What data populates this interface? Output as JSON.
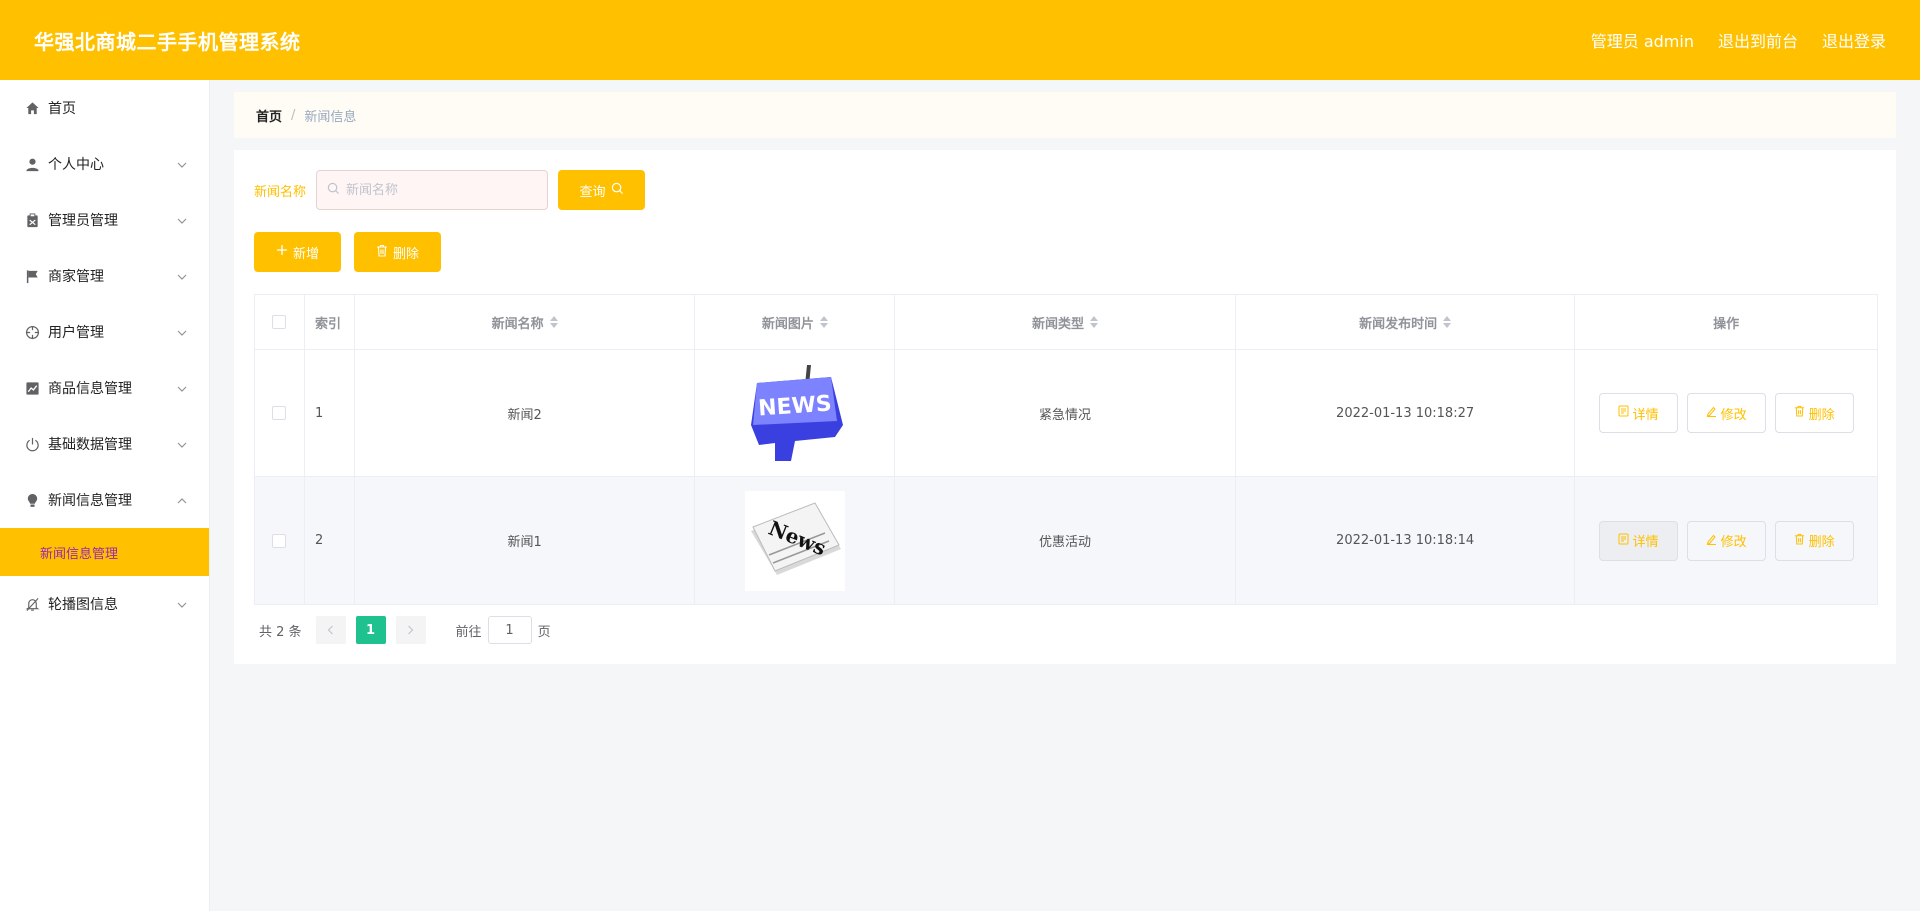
{
  "header": {
    "title": "华强北商城二手手机管理系统",
    "user_label": "管理员 admin",
    "front_link": "退出到前台",
    "logout_link": "退出登录"
  },
  "sidebar": {
    "items": [
      {
        "label": "首页",
        "icon": "home-icon",
        "expandable": false
      },
      {
        "label": "个人中心",
        "icon": "user-icon",
        "expandable": true
      },
      {
        "label": "管理员管理",
        "icon": "clipboard-icon",
        "expandable": true
      },
      {
        "label": "商家管理",
        "icon": "flag-icon",
        "expandable": true
      },
      {
        "label": "用户管理",
        "icon": "crosshair-icon",
        "expandable": true
      },
      {
        "label": "商品信息管理",
        "icon": "chart-icon",
        "expandable": true
      },
      {
        "label": "基础数据管理",
        "icon": "power-icon",
        "expandable": true
      },
      {
        "label": "新闻信息管理",
        "icon": "bulb-icon",
        "expandable": true,
        "expanded": true
      },
      {
        "label": "轮播图信息",
        "icon": "bell-off-icon",
        "expandable": true
      }
    ],
    "active_sub": "新闻信息管理"
  },
  "breadcrumb": {
    "home": "首页",
    "separator": "/",
    "current": "新闻信息"
  },
  "search": {
    "label": "新闻名称",
    "placeholder": "新闻名称",
    "value": "",
    "button": "查询"
  },
  "actions": {
    "add": "新增",
    "delete": "删除"
  },
  "table": {
    "columns": [
      "索引",
      "新闻名称",
      "新闻图片",
      "新闻类型",
      "新闻发布时间",
      "操作"
    ],
    "rows": [
      {
        "index": "1",
        "name": "新闻2",
        "image": "news-key-image",
        "type": "紧急情况",
        "time": "2022-01-13 10:18:27"
      },
      {
        "index": "2",
        "name": "新闻1",
        "image": "newspaper-image",
        "type": "优惠活动",
        "time": "2022-01-13 10:18:14"
      }
    ],
    "row_buttons": {
      "detail": "详情",
      "edit": "修改",
      "delete": "删除"
    }
  },
  "pagination": {
    "total": "共 2 条",
    "current_page": "1",
    "goto_label": "前往",
    "goto_value": "1",
    "page_suffix": "页"
  },
  "colors": {
    "accent": "#ffc000",
    "page_active": "#1fc28f",
    "submenu_text": "#9c27b0"
  }
}
